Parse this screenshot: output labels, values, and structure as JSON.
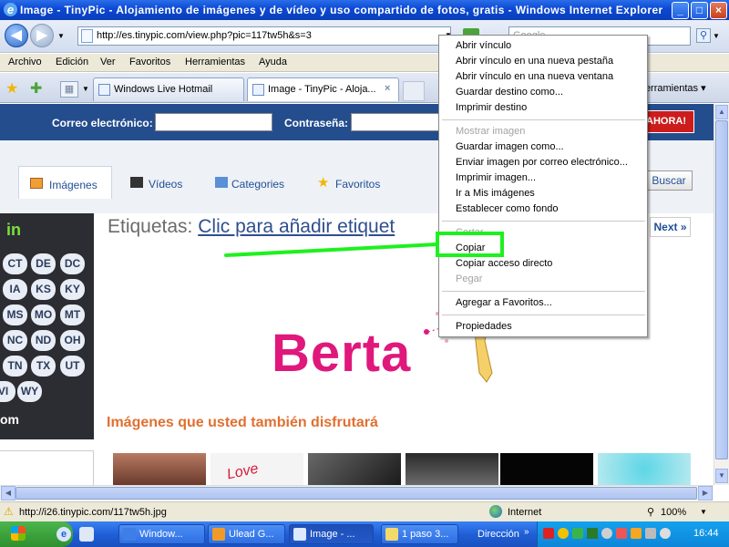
{
  "window": {
    "title": "Image - TinyPic - Alojamiento de imágenes y de vídeo y uso compartido de fotos, gratis - Windows Internet Explorer",
    "ie_glyph": "e",
    "minimize": "_",
    "maximize": "□",
    "close": "×"
  },
  "address": {
    "back": "◀",
    "forward": "▶",
    "url": "http://es.tinypic.com/view.php?pic=117tw5h&s=3",
    "search_placeholder": "Google"
  },
  "menubar": [
    "Archivo",
    "Edición",
    "Ver",
    "Favoritos",
    "Herramientas",
    "Ayuda"
  ],
  "tabs": [
    {
      "label": "Windows Live Hotmail"
    },
    {
      "label": "Image - TinyPic - Aloja...",
      "close": "×"
    }
  ],
  "toolbar_right": {
    "label": "Herramientas ▾"
  },
  "page": {
    "login": {
      "email_label": "Correo electrónico:",
      "password_label": "Contraseña:",
      "signup": "AHORA!"
    },
    "nav_tabs": [
      "Imágenes",
      "Vídeos",
      "Categories",
      "Favoritos"
    ],
    "search_button": "Buscar",
    "map": {
      "heading": "in",
      "states": [
        "CT",
        "DE",
        "DC",
        "IA",
        "KS",
        "KY",
        "MS",
        "MO",
        "MT",
        "NC",
        "ND",
        "OH",
        "TN",
        "TX",
        "UT",
        "VI",
        "WY"
      ],
      "footer": "om"
    },
    "tags_label": "Etiquetas:",
    "tags_link": "Clic para añadir etiquet",
    "next": "Next »",
    "image_text": "Berta",
    "similar_heading": "Imágenes que usted también disfrutará",
    "thumb_text": "Love"
  },
  "context_menu": [
    {
      "label": "Abrir vínculo",
      "enabled": true
    },
    {
      "label": "Abrir vínculo en una nueva pestaña",
      "enabled": true
    },
    {
      "label": "Abrir vínculo en una nueva ventana",
      "enabled": true
    },
    {
      "label": "Guardar destino como...",
      "enabled": true
    },
    {
      "label": "Imprimir destino",
      "enabled": true
    },
    {
      "label": "Mostrar imagen",
      "enabled": false
    },
    {
      "label": "Guardar imagen como...",
      "enabled": true
    },
    {
      "label": "Enviar imagen por correo electrónico...",
      "enabled": true
    },
    {
      "label": "Imprimir imagen...",
      "enabled": true
    },
    {
      "label": "Ir a Mis imágenes",
      "enabled": true
    },
    {
      "label": "Establecer como fondo",
      "enabled": true
    },
    {
      "label": "Cortar",
      "enabled": false
    },
    {
      "label": "Copiar",
      "enabled": true,
      "highlighted": true
    },
    {
      "label": "Copiar acceso directo",
      "enabled": true
    },
    {
      "label": "Pegar",
      "enabled": false
    },
    {
      "label": "Agregar a Favoritos...",
      "enabled": true
    },
    {
      "label": "Propiedades",
      "enabled": true
    }
  ],
  "statusbar": {
    "url": "http://i26.tinypic.com/117tw5h.jpg",
    "zone": "Internet",
    "zoom": "100%"
  },
  "taskbar": {
    "items": [
      {
        "label": "Window...",
        "active": false
      },
      {
        "label": "Ulead G...",
        "active": false
      },
      {
        "label": "Image - ...",
        "active": true
      },
      {
        "label": "1 paso 3...",
        "active": false
      }
    ],
    "address_label": "Dirección",
    "clock": "16:44"
  },
  "colors": {
    "title_blue": "#0b48d4",
    "login_bar": "#244d8e",
    "berta_pink": "#e0187b",
    "similar_orange": "#e07030",
    "annotation_green": "#1ff01f",
    "map_green": "#79e13b"
  }
}
